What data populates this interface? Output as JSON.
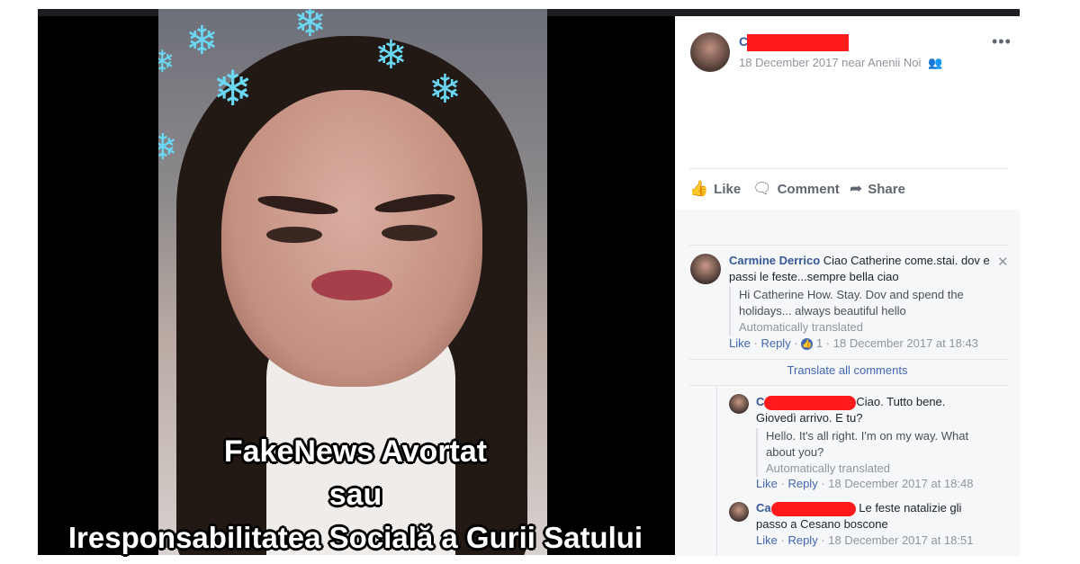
{
  "post": {
    "author_initial": "C",
    "date_location": "18 December 2017 near Anenii Noi",
    "privacy_icon": "friends-icon",
    "more_label": "•••"
  },
  "actions": {
    "like": "Like",
    "comment": "Comment",
    "share": "Share"
  },
  "comments": [
    {
      "author": "Carmine Derrico",
      "text": "Ciao Catherine come.stai. dov e passi le feste...sempre bella ciao",
      "translation": "Hi Catherine How. Stay. Dov and spend the holidays... always beautiful hello",
      "translation_note": "Automatically translated",
      "like": "Like",
      "reply": "Reply",
      "reactions": "1",
      "timestamp": "18 December 2017 at 18:43"
    }
  ],
  "translate_all": "Translate all comments",
  "replies": [
    {
      "author_initial": "C",
      "text": "Ciao. Tutto bene. Giovedì arrivo. E tu?",
      "translation": "Hello. It's all right. I'm on my way. What about you?",
      "translation_note": "Automatically translated",
      "like": "Like",
      "reply": "Reply",
      "timestamp": "18 December 2017 at 18:48"
    },
    {
      "author_initial": "Ca",
      "text": "Le feste natalizie gli passo a Cesano boscone",
      "like": "Like",
      "reply": "Reply",
      "timestamp": "18 December 2017 at 18:51"
    }
  ],
  "headline": {
    "line1": "FakeNews Avortat",
    "line2": "sau",
    "line3": "Iresponsabilitatea Socială a Gurii Satului"
  },
  "colors": {
    "link": "#365899",
    "muted": "#90949c",
    "redaction": "#ff1b1b",
    "snowflake": "#6ad8f4"
  }
}
